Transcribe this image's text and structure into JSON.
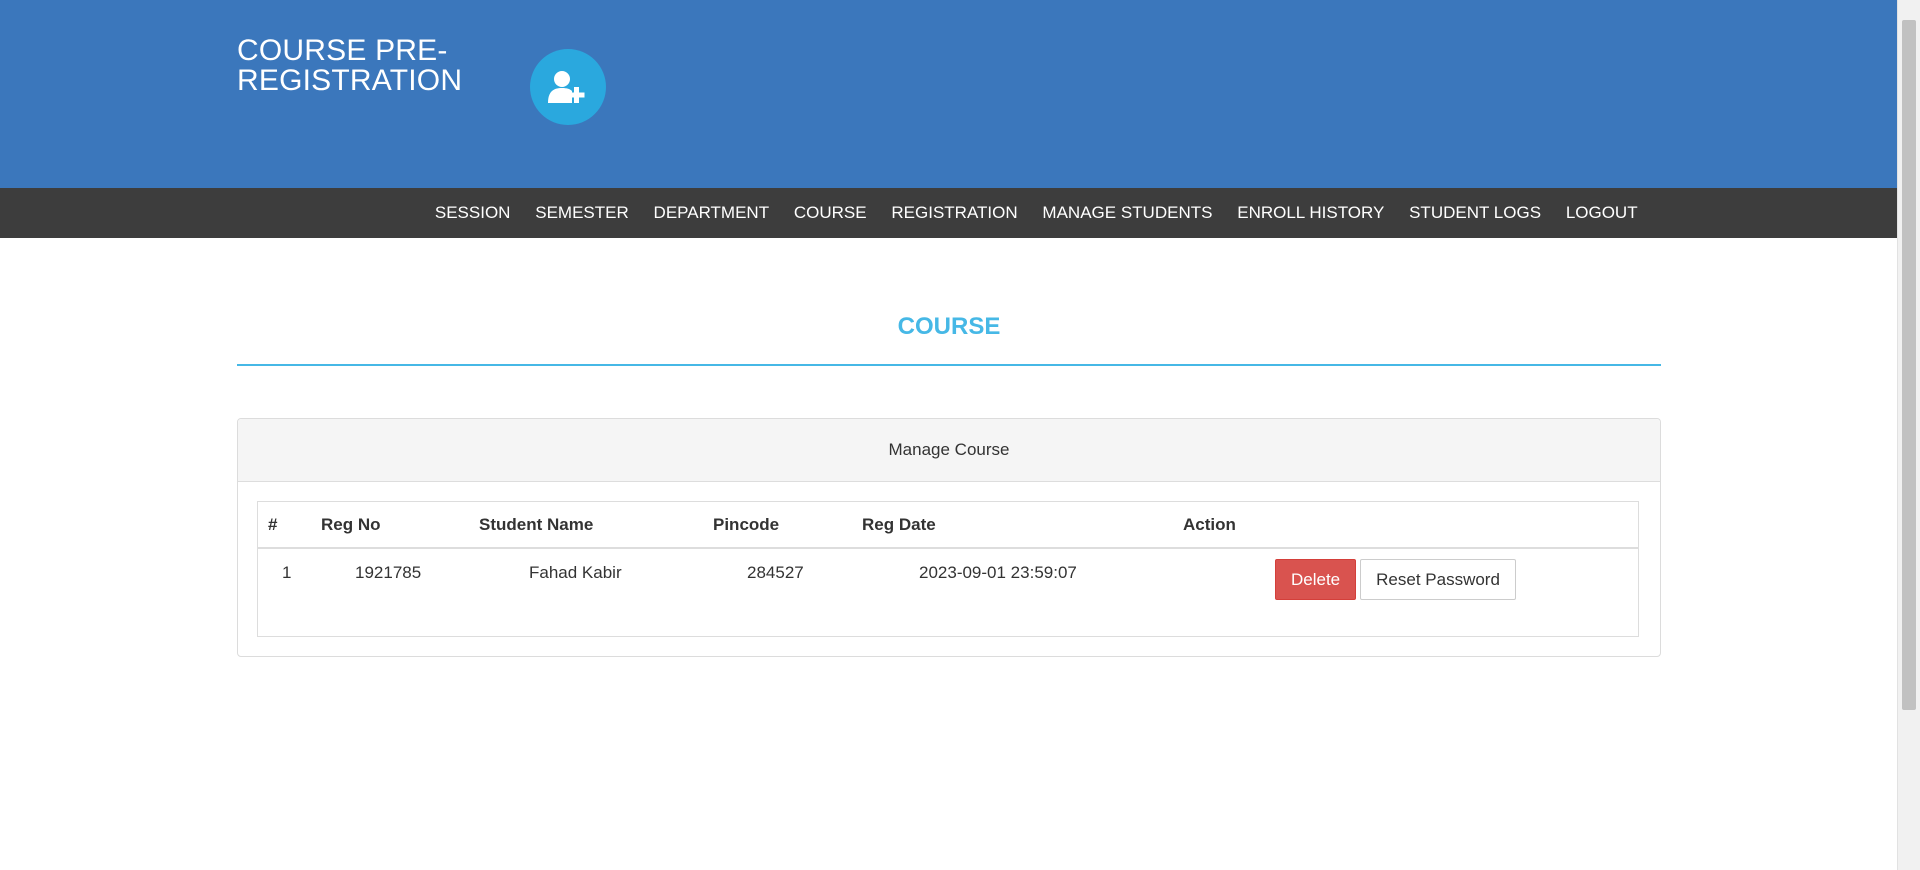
{
  "header": {
    "title": "COURSE PRE-REGISTRATION",
    "brand_icon": "user-plus-icon"
  },
  "nav": {
    "items": [
      {
        "label": "SESSION"
      },
      {
        "label": "SEMESTER"
      },
      {
        "label": "DEPARTMENT"
      },
      {
        "label": "COURSE"
      },
      {
        "label": "REGISTRATION"
      },
      {
        "label": "MANAGE STUDENTS"
      },
      {
        "label": "ENROLL HISTORY"
      },
      {
        "label": "STUDENT LOGS"
      },
      {
        "label": "LOGOUT"
      }
    ]
  },
  "main": {
    "section_title": "COURSE",
    "panel_heading": "Manage Course",
    "table": {
      "columns": [
        "#",
        "Reg No",
        "Student Name",
        "Pincode",
        "Reg Date",
        "Action"
      ],
      "rows": [
        {
          "index": "1",
          "reg_no": "1921785",
          "student_name": "Fahad Kabir",
          "pincode": "284527",
          "reg_date": "2023-09-01 23:59:07",
          "delete_label": "Delete",
          "reset_label": "Reset Password"
        }
      ]
    }
  },
  "colors": {
    "header_bg": "#3b77bc",
    "navbar_bg": "#3d3d3d",
    "accent": "#46b8e6",
    "icon_circle": "#2aa8de",
    "danger": "#d9534f"
  }
}
